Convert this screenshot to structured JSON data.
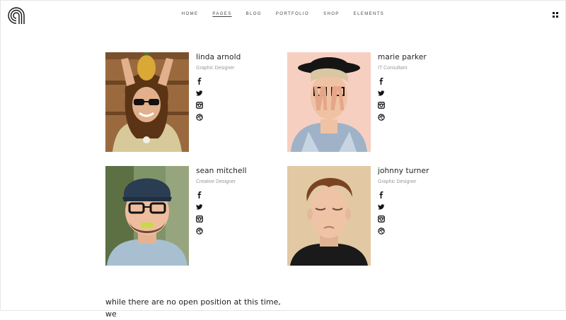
{
  "header": {
    "nav": [
      "HOME",
      "PAGES",
      "BLOG",
      "PORTFOLIO",
      "SHOP",
      "ELEMENTS"
    ],
    "active_index": 1
  },
  "team": [
    {
      "name": "linda arnold",
      "role": "Graphic Designer"
    },
    {
      "name": "marie parker",
      "role": "IT Consultant"
    },
    {
      "name": "sean mitchell",
      "role": "Creative Designer"
    },
    {
      "name": "johnny turner",
      "role": "Graphic Designer"
    }
  ],
  "social_icons": [
    "facebook-icon",
    "twitter-icon",
    "instagram-icon",
    "dribbble-icon"
  ],
  "footer_text": "while there are no open position at this time, we",
  "colors": {
    "text": "#222222",
    "muted": "#9a9a9a",
    "accent": "#111111"
  }
}
